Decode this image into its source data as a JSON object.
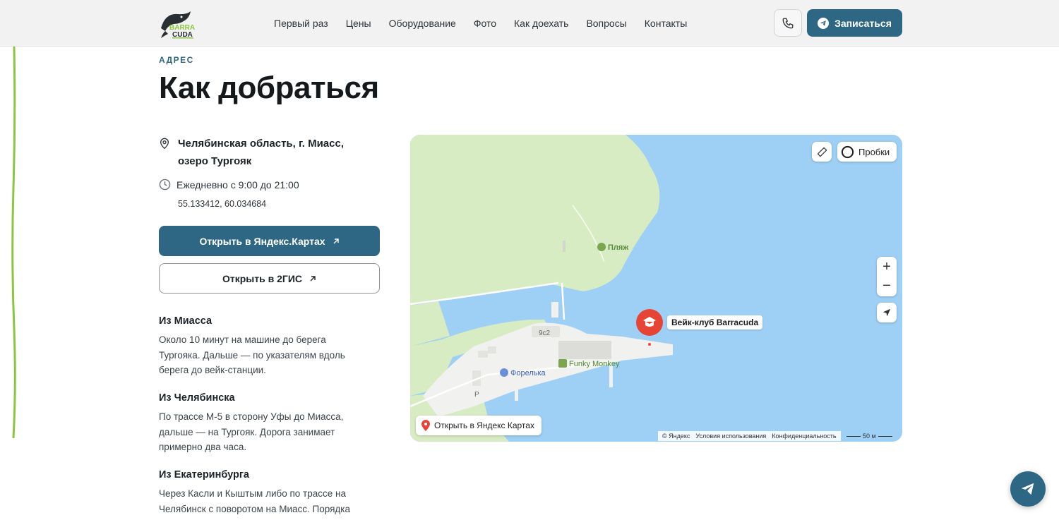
{
  "header": {
    "nav": [
      "Первый раз",
      "Цены",
      "Оборудование",
      "Фото",
      "Как доехать",
      "Вопросы",
      "Контакты"
    ],
    "signup_label": "Записаться",
    "logo_text_top": "BARRA",
    "logo_text_bottom": "CUDA",
    "icons": {
      "phone": "phone-icon",
      "telegram": "telegram-icon",
      "logo": "barracuda-logo"
    }
  },
  "section": {
    "eyebrow": "АДРЕС",
    "title": "Как добраться",
    "address_line1": "Челябинская область, г. Миасс,",
    "address_line2": "озеро Тургояк",
    "hours": "Ежедневно с 9:00 до 21:00",
    "coords": "55.133412, 60.034684",
    "btn_yandex": "Открыть в Яндекс.Картах",
    "btn_2gis": "Открыть в 2ГИС"
  },
  "routes": [
    {
      "title": "Из Миасса",
      "lines": [
        "Около 10 минут на машине до берега",
        "Тургояка. Дальше — по указателям вдоль",
        "берега до вейк-станции."
      ]
    },
    {
      "title": "Из Челябинска",
      "lines": [
        "По трассе М-5 в сторону Уфы до Миасса,",
        "дальше — на Тургояк. Дорога занимает",
        "примерно два часа."
      ]
    },
    {
      "title": "Из Екатеринбурга",
      "lines": [
        "Через Касли и Кыштым либо по трассе на",
        "Челябинск с поворотом на Миасс. Порядка"
      ]
    }
  ],
  "map": {
    "traffic_label": "Пробки",
    "beach_label": "Пляж",
    "pin_label": "Вейк-клуб Barracuda",
    "poi_forelka": "Форелька",
    "poi_funky": "Funky Monkey",
    "building_label": "9с2",
    "parking_label": "P",
    "open_label": "Открыть в Яндекс Картах",
    "copyright": "© Яндекс",
    "terms": "Условия использования",
    "privacy": "Конфиденциальность",
    "scale": "50 м",
    "colors": {
      "water": "#9ecff5",
      "land": "#d8ecc3",
      "built": "#f1f1ef",
      "pin": "#e64535"
    }
  },
  "colors": {
    "accent": "#2e6783",
    "green_line": "#8cc63f"
  }
}
